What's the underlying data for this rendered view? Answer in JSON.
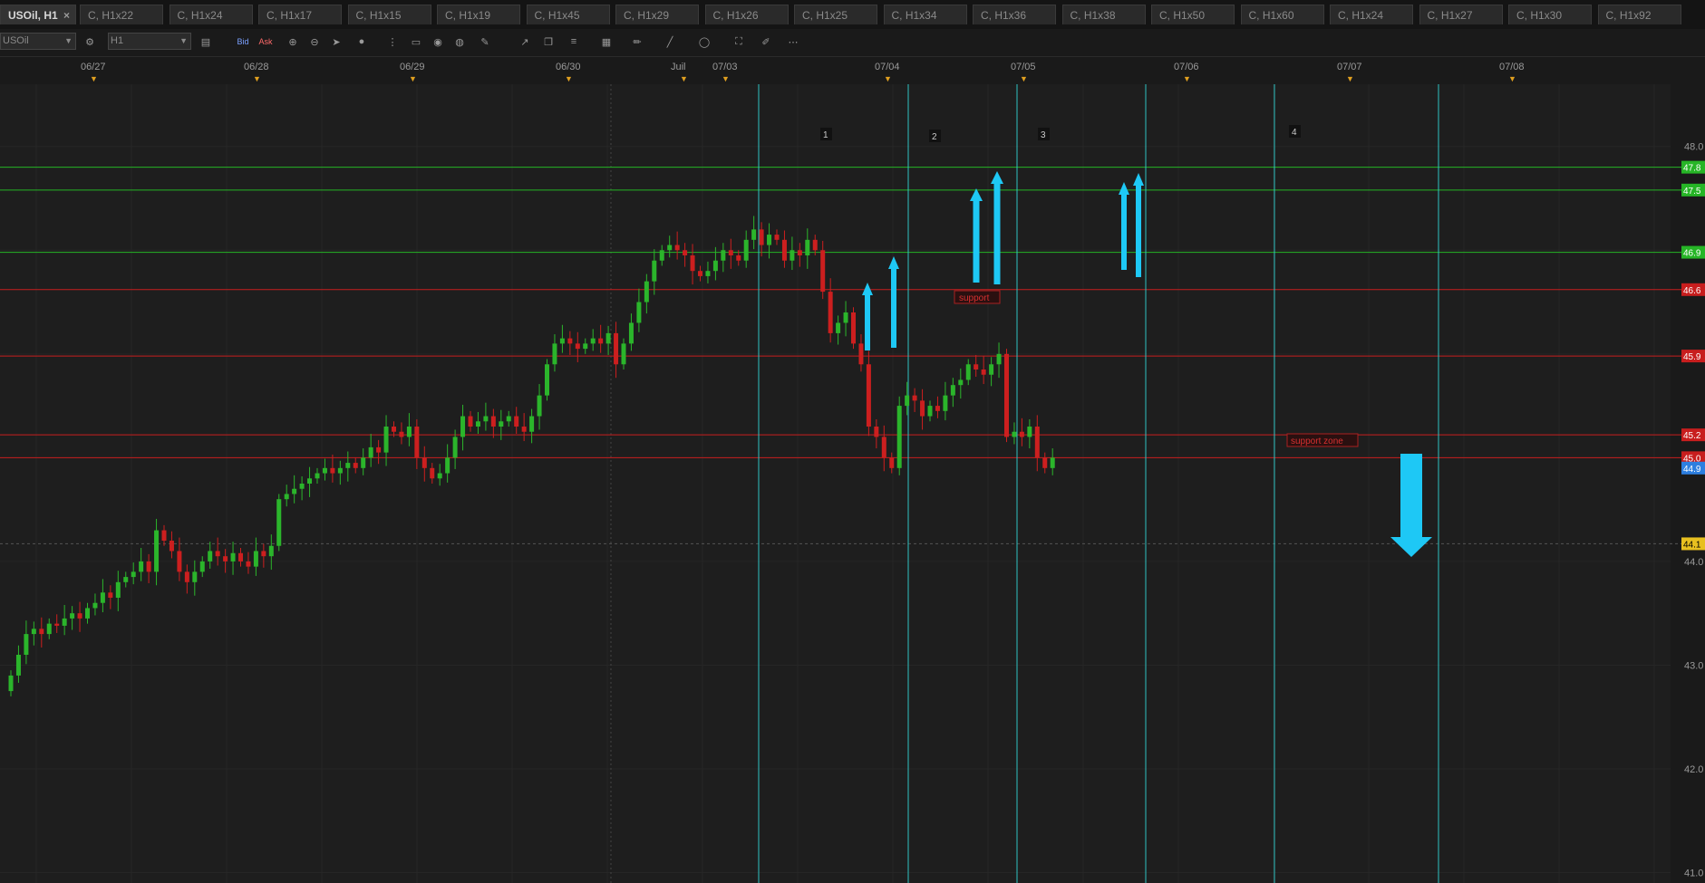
{
  "tabs": [
    {
      "label": "USOil, H1",
      "active": true,
      "close": "×"
    },
    {
      "label": "C, H1x22"
    },
    {
      "label": "C, H1x24"
    },
    {
      "label": "C, H1x17"
    },
    {
      "label": "C, H1x15"
    },
    {
      "label": "C, H1x19"
    },
    {
      "label": "C, H1x45"
    },
    {
      "label": "C, H1x29"
    },
    {
      "label": "C, H1x26"
    },
    {
      "label": "C, H1x25"
    },
    {
      "label": "C, H1x34"
    },
    {
      "label": "C, H1x36"
    },
    {
      "label": "C, H1x38"
    },
    {
      "label": "C, H1x50"
    },
    {
      "label": "C, H1x60"
    },
    {
      "label": "C, H1x24"
    },
    {
      "label": "C, H1x27"
    },
    {
      "label": "C, H1x30"
    },
    {
      "label": "C, H1x92"
    }
  ],
  "toolbar": {
    "symbol": "USOil",
    "timeframe": "H1",
    "bid_label": "Bid",
    "ask_label": "Ask"
  },
  "date_axis": {
    "labels": [
      "06/27",
      "06/28",
      "06/29",
      "06/30",
      "Juil",
      "07/03",
      "07/04",
      "07/05",
      "07/06",
      "07/07",
      "07/08"
    ],
    "marker": "▼"
  },
  "colors": {
    "background": "#1e1e1e",
    "bull": "#2bb52b",
    "bear": "#cc1f1f",
    "resistance_line": "#26b526",
    "support_line": "#c81e1e",
    "session_line": "#2fc3c3",
    "arrow": "#1ec8f5",
    "current_price": "#e8c020"
  },
  "chart_data": {
    "type": "candlestick",
    "ylim": [
      40.9,
      48.6
    ],
    "y_ticks": [
      "48.0",
      "47.0",
      "46.0",
      "45.0",
      "44.0",
      "43.0",
      "42.0",
      "41.0"
    ],
    "hlines": [
      {
        "price": 47.8,
        "label": "47.8",
        "color": "green"
      },
      {
        "price": 47.58,
        "label": "47.5",
        "color": "green"
      },
      {
        "price": 46.98,
        "label": "46.9",
        "color": "green"
      },
      {
        "price": 46.62,
        "label": "46.6",
        "color": "red"
      },
      {
        "price": 45.98,
        "label": "45.9",
        "color": "red"
      },
      {
        "price": 45.22,
        "label": "45.2",
        "color": "red"
      },
      {
        "price": 45.0,
        "label": "45.0",
        "color": "red"
      }
    ],
    "current_bid": {
      "price": 44.9,
      "label": "44.9"
    },
    "crosshair": {
      "price": 44.17,
      "label": "44.1"
    },
    "vertical_markers": [
      "1",
      "2",
      "3",
      "4"
    ],
    "annotations": [
      "support",
      "support zone"
    ],
    "series": [
      {
        "name": "USOil, H1",
        "closes": [
          42.9,
          43.1,
          43.3,
          43.35,
          43.3,
          43.4,
          43.38,
          43.45,
          43.5,
          43.45,
          43.55,
          43.6,
          43.7,
          43.65,
          43.8,
          43.85,
          43.9,
          44.0,
          43.9,
          44.3,
          44.2,
          44.1,
          43.9,
          43.8,
          43.9,
          44.0,
          44.1,
          44.05,
          44.0,
          44.08,
          44.0,
          43.95,
          44.1,
          44.05,
          44.15,
          44.6,
          44.65,
          44.7,
          44.75,
          44.8,
          44.85,
          44.9,
          44.85,
          44.9,
          44.95,
          44.9,
          45.0,
          45.1,
          45.05,
          45.3,
          45.25,
          45.2,
          45.3,
          45.0,
          44.9,
          44.8,
          44.85,
          45.0,
          45.2,
          45.4,
          45.3,
          45.35,
          45.4,
          45.3,
          45.35,
          45.4,
          45.3,
          45.25,
          45.4,
          45.6,
          45.9,
          46.1,
          46.15,
          46.1,
          46.05,
          46.1,
          46.15,
          46.1,
          46.2,
          45.9,
          46.1,
          46.3,
          46.5,
          46.7,
          46.9,
          47.0,
          47.05,
          47.0,
          46.95,
          46.8,
          46.75,
          46.8,
          46.9,
          47.0,
          46.95,
          46.9,
          47.1,
          47.2,
          47.05,
          47.15,
          47.1,
          46.9,
          47.0,
          46.95,
          47.1,
          47.0,
          46.6,
          46.2,
          46.3,
          46.4,
          46.1,
          45.9,
          45.3,
          45.2,
          45.0,
          44.9,
          45.5,
          45.6,
          45.55,
          45.4,
          45.5,
          45.45,
          45.6,
          45.7,
          45.75,
          45.9,
          45.85,
          45.8,
          45.9,
          46.0,
          45.2,
          45.25,
          45.2,
          45.3,
          45.0,
          44.9,
          45.0
        ]
      }
    ]
  }
}
